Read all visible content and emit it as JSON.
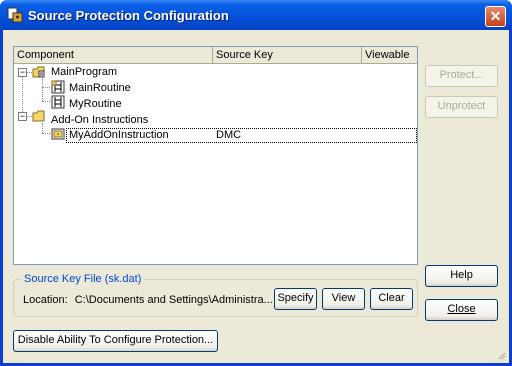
{
  "window": {
    "title": "Source Protection Configuration"
  },
  "tree": {
    "columns": [
      "Component",
      "Source Key",
      "Viewable"
    ],
    "rows": [
      {
        "label": "MainProgram",
        "key": "",
        "viewable": ""
      },
      {
        "label": "MainRoutine",
        "key": "",
        "viewable": ""
      },
      {
        "label": "MyRoutine",
        "key": "",
        "viewable": ""
      },
      {
        "label": "Add-On Instructions",
        "key": "",
        "viewable": ""
      },
      {
        "label": "MyAddOnInstruction",
        "key": "DMC",
        "viewable": ""
      }
    ]
  },
  "key_file": {
    "group_label": "Source Key File (sk.dat)",
    "location_label": "Location:",
    "location_value": "C:\\Documents and Settings\\Administra..."
  },
  "buttons": {
    "protect": "Protect...",
    "unprotect": "Unprotect",
    "help": "Help",
    "close": "Close",
    "specify": "Specify",
    "view": "View",
    "clear": "Clear",
    "disable": "Disable Ability To Configure Protection..."
  },
  "icons": {
    "app": "source-protection-icon",
    "close": "close-icon",
    "program": "program-folder-icon",
    "routine": "ladder-routine-icon",
    "folder": "folder-icon",
    "aoi": "add-on-instruction-icon"
  }
}
